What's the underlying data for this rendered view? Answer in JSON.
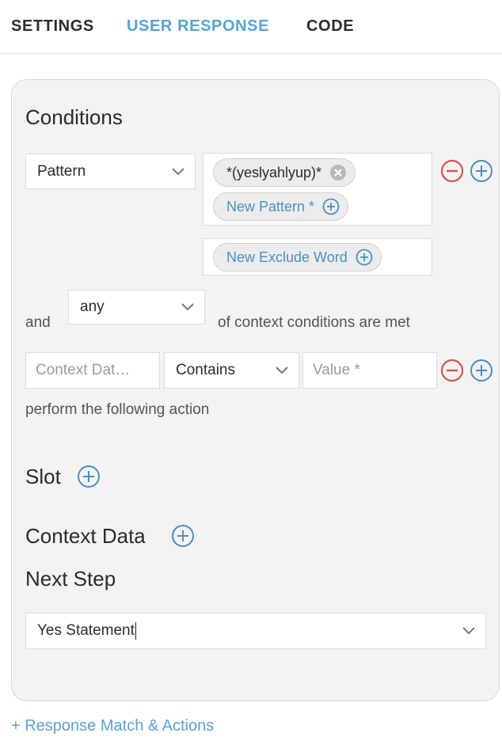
{
  "tabs": [
    {
      "label": "SETTINGS",
      "active": false
    },
    {
      "label": "USER RESPONSE",
      "active": true
    },
    {
      "label": "CODE",
      "active": false
    }
  ],
  "conditions": {
    "heading": "Conditions",
    "type_select": "Pattern",
    "patterns": [
      "*(yeslyahlyup)*"
    ],
    "new_pattern_label": "New Pattern *",
    "new_exclude_label": "New Exclude Word",
    "and_label": "and",
    "match_select": "any",
    "context_suffix": "of context conditions are met",
    "context_row": {
      "data_placeholder": "Context Dat…",
      "operator": "Contains",
      "value_placeholder": "Value *"
    },
    "action_label": "perform the following action"
  },
  "slot": {
    "heading": "Slot"
  },
  "context_data": {
    "heading": "Context Data"
  },
  "next_step": {
    "heading": "Next Step",
    "value": "Yes Statement"
  },
  "footer": {
    "add_link": "+ Response Match & Actions"
  },
  "colors": {
    "accent": "#5ba3cf",
    "remove": "#d9534f",
    "add": "#4b8fbf"
  }
}
